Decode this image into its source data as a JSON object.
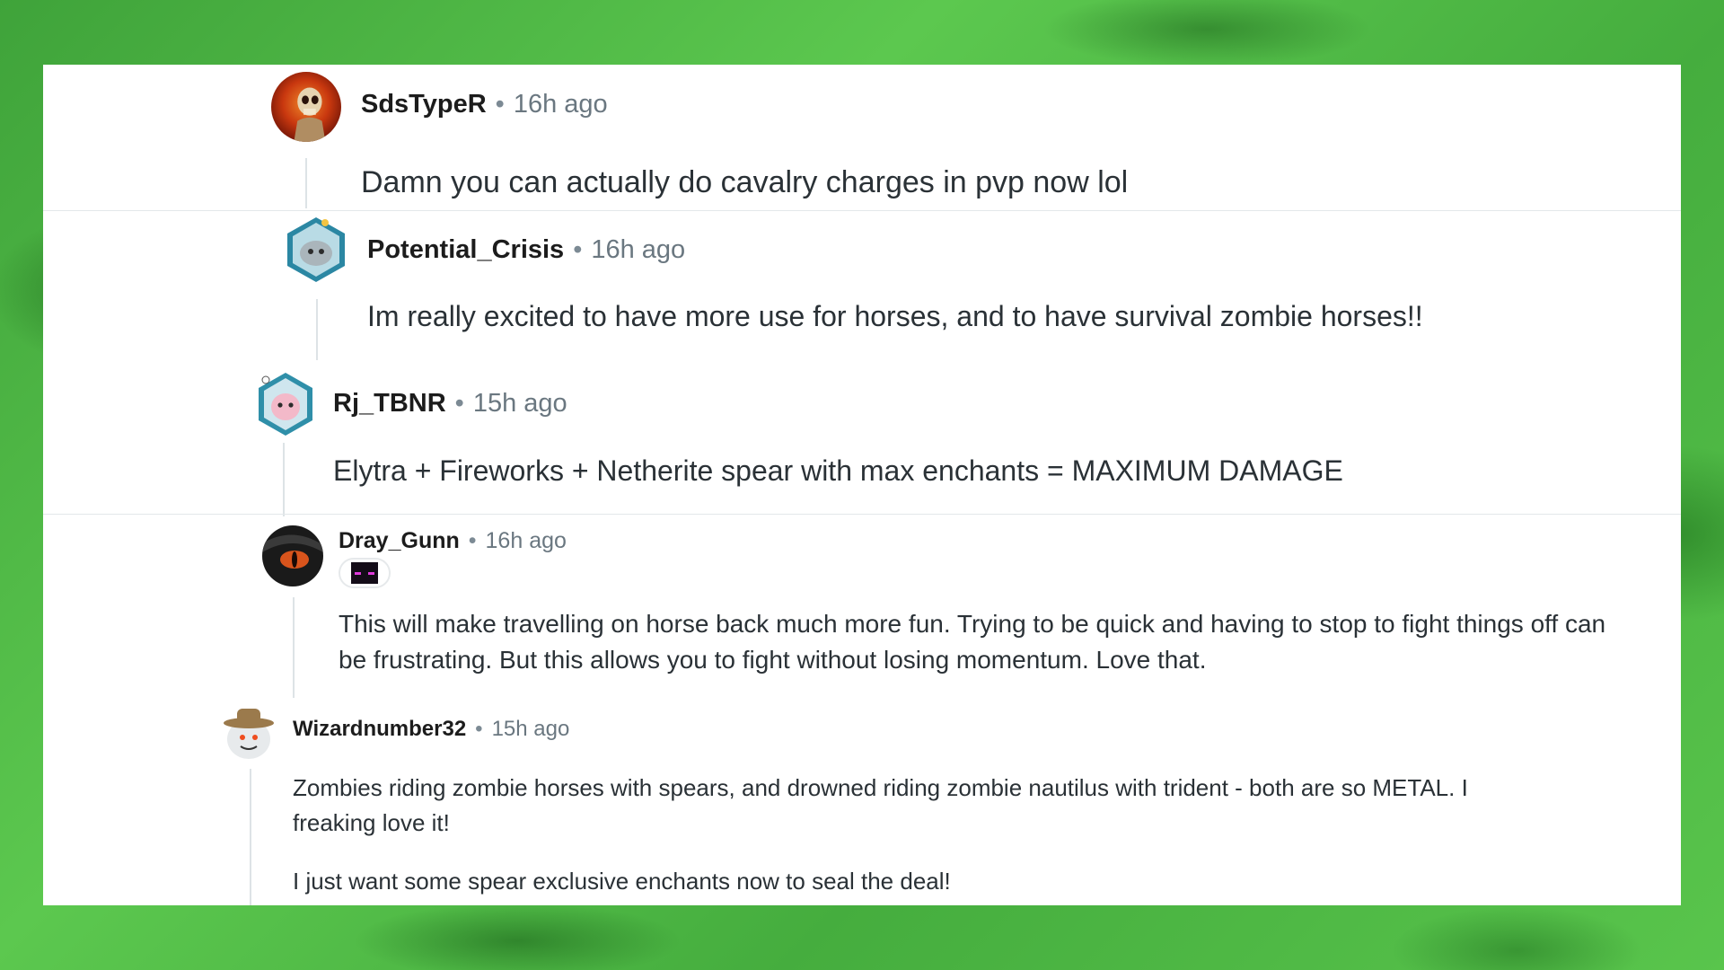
{
  "comments": [
    {
      "username": "SdsTypeR",
      "separator": "•",
      "time": "16h ago",
      "text": "Damn you can actually do cavalry charges in pvp now lol"
    },
    {
      "username": "Potential_Crisis",
      "separator": "•",
      "time": "16h ago",
      "text": "Im really excited to have more use for horses, and to have survival zombie horses!!"
    },
    {
      "username": "Rj_TBNR",
      "separator": "•",
      "time": "15h ago",
      "text": "Elytra + Fireworks + Netherite spear with max enchants = MAXIMUM DAMAGE"
    },
    {
      "username": "Dray_Gunn",
      "separator": "•",
      "time": "16h ago",
      "flair_icon": "enderman-face-icon",
      "text": "This will make travelling on horse back much more fun. Trying to be quick and having to stop to fight things off can be frustrating. But this allows you to fight without losing momentum. Love that."
    },
    {
      "username": "Wizardnumber32",
      "separator": "•",
      "time": "15h ago",
      "text": "Zombies riding zombie horses with spears, and drowned riding zombie nautilus with trident - both are so METAL. I freaking love it!",
      "text2": "I just want some spear exclusive enchants now to seal the deal!"
    }
  ],
  "colors": {
    "background_green": "#4fb845",
    "card": "#ffffff",
    "username": "#1c1c1c",
    "meta": "#6a7780",
    "body_text": "#2a3136",
    "thread_line": "#dde3e6"
  },
  "avatars": [
    "skull-fire-avatar-icon",
    "snoo-hexagon-avatar-icon",
    "snoo-axolotl-avatar-icon",
    "dragon-eye-avatar-icon",
    "snoo-cowboy-avatar-icon"
  ]
}
